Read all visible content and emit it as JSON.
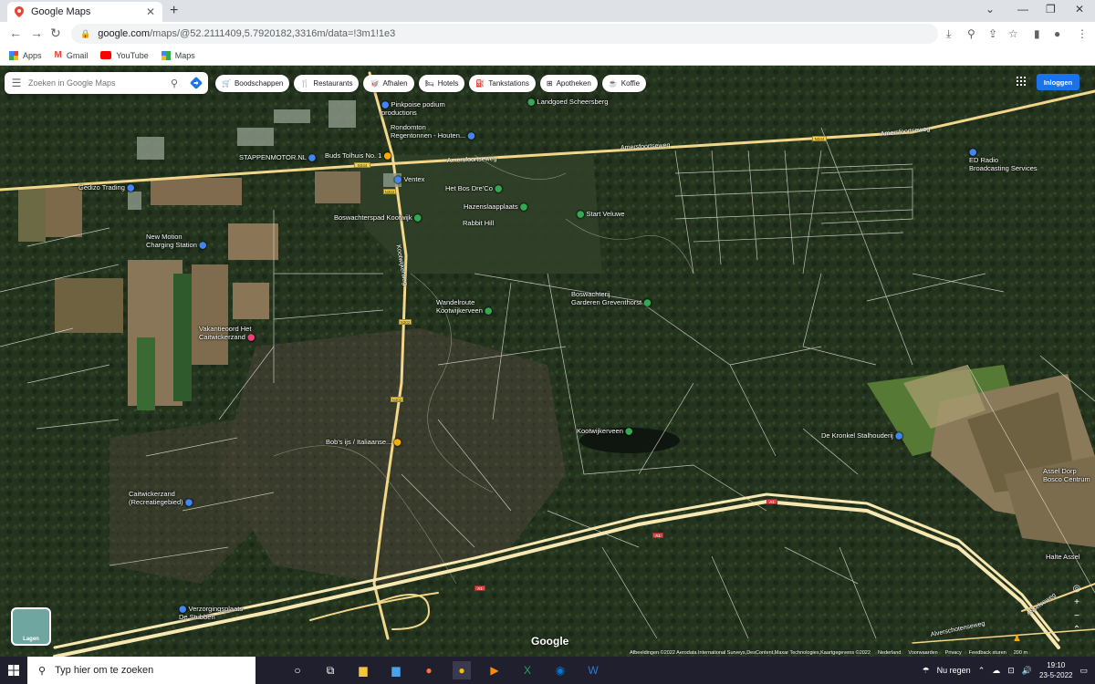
{
  "browser": {
    "tab_title": "Google Maps",
    "new_tab": "+",
    "url_host": "google.com",
    "url_path": "/maps/@52.2111409,5.7920182,3316m/data=!3m1!1e3",
    "bookmarks": [
      {
        "label": "Apps"
      },
      {
        "label": "Gmail"
      },
      {
        "label": "YouTube"
      },
      {
        "label": "Maps"
      }
    ]
  },
  "maps": {
    "search_placeholder": "Zoeken in Google Maps",
    "chips": [
      {
        "label": "Boodschappen",
        "icon": "cart-icon"
      },
      {
        "label": "Restaurants",
        "icon": "fork-knife-icon"
      },
      {
        "label": "Afhalen",
        "icon": "takeout-icon"
      },
      {
        "label": "Hotels",
        "icon": "bed-icon"
      },
      {
        "label": "Tankstations",
        "icon": "fuel-icon"
      },
      {
        "label": "Apotheken",
        "icon": "pharmacy-icon"
      },
      {
        "label": "Koffie",
        "icon": "coffee-icon"
      }
    ],
    "signin": "Inloggen",
    "layers_label": "Lagen",
    "google_logo": "Google",
    "attribution": [
      "Afbeeldingen ©2022 Aerodata International Surveys,DesContent,Maxar Technologies,Kaartgegevens ©2022",
      "Nederland",
      "Voorwaarden",
      "Privacy",
      "Feedback sturen",
      "200 m"
    ],
    "places": [
      {
        "name": "Pinkpoise podium\nproductions"
      },
      {
        "name": "Rondomton\nRegentonnen - Houten..."
      },
      {
        "name": "Landgoed Scheersberg"
      },
      {
        "name": "Buds Tolhuis No. 1"
      },
      {
        "name": "STAPPENMOTOR.NL"
      },
      {
        "name": "Ventex"
      },
      {
        "name": "Gedizo Trading"
      },
      {
        "name": "Het Bos Dre'Co"
      },
      {
        "name": "Boswachterspad Kootwijk"
      },
      {
        "name": "Hazenslaapplaats"
      },
      {
        "name": "Rabbit Hill"
      },
      {
        "name": "Start Veluwe"
      },
      {
        "name": "New Motion\nCharging Station"
      },
      {
        "name": "ED Radio\nBroadcasting Services"
      },
      {
        "name": "Wandelroute\nKootwijkerveen"
      },
      {
        "name": "Boswachterij\nGarderen Greventhorst"
      },
      {
        "name": "Vakantieoord Het\nCaitwickerzand"
      },
      {
        "name": "Bob's ijs / Italiaanse..."
      },
      {
        "name": "Kootwijkerveen"
      },
      {
        "name": "De Kronkel Stalhouderij"
      },
      {
        "name": "Caitwickerzand\n(Recreatiegebied)"
      },
      {
        "name": "Assel Dorp\nBosco Centrum"
      },
      {
        "name": "Halte Assel"
      },
      {
        "name": "Verzorgingsplaats\nDe Stubben"
      }
    ],
    "roads": [
      "Amersfoortseweg",
      "Amersfoortseweg",
      "Amersfoortseweg",
      "Kootwijkerweg",
      "Asselseweg",
      "Alverschotenseweg"
    ],
    "road_shields": [
      "N344",
      "N302",
      "N302",
      "N302",
      "A1",
      "A1",
      "A1",
      "N344"
    ]
  },
  "taskbar": {
    "search_placeholder": "Typ hier om te zoeken",
    "weather": "Nu regen",
    "time": "19:10",
    "date": "23-5-2022"
  }
}
